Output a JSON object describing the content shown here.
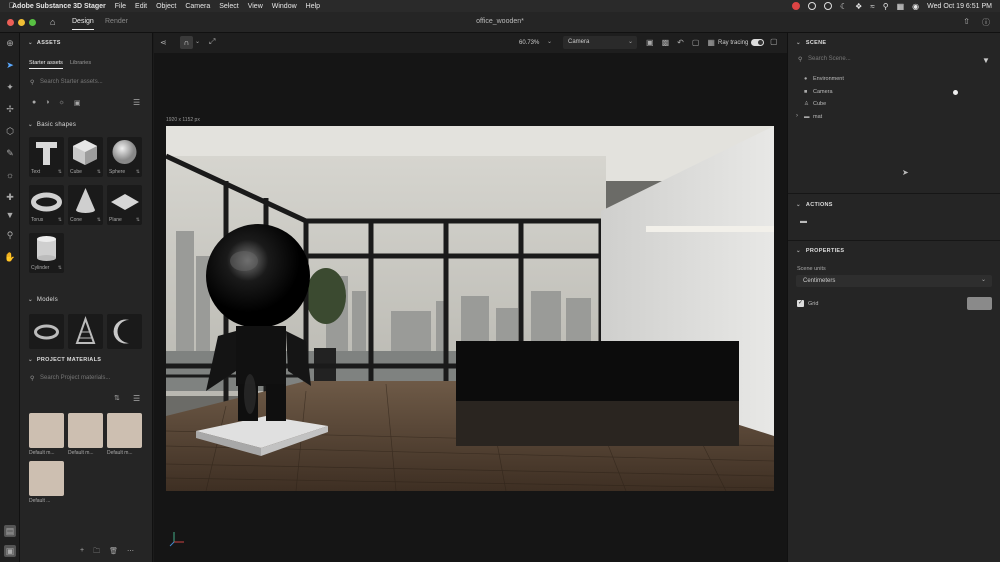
{
  "menubar": {
    "app_name": "Adobe Substance 3D Stager",
    "items": [
      "File",
      "Edit",
      "Object",
      "Camera",
      "Select",
      "View",
      "Window",
      "Help"
    ],
    "clock": "Wed Oct 19  6:51 PM"
  },
  "titlebar": {
    "tabs": [
      "Design",
      "Render"
    ],
    "document_title": "office_wooden*"
  },
  "left_panel": {
    "assets_header": "ASSETS",
    "asset_tabs": [
      "Starter assets",
      "Libraries"
    ],
    "search_placeholder": "Search Starter assets...",
    "basic_shapes_header": "Basic shapes",
    "shapes": [
      {
        "label": "Text"
      },
      {
        "label": "Cube"
      },
      {
        "label": "Sphere"
      },
      {
        "label": "Torus"
      },
      {
        "label": "Cone"
      },
      {
        "label": "Plane"
      },
      {
        "label": "Cylinder"
      }
    ],
    "models_header": "Models",
    "project_materials_header": "PROJECT MATERIALS",
    "materials_search_placeholder": "Search Project materials...",
    "materials": [
      {
        "label": "Default m..."
      },
      {
        "label": "Default m..."
      },
      {
        "label": "Default m..."
      },
      {
        "label": "Default ..."
      }
    ]
  },
  "viewport": {
    "zoom": "60.73%",
    "camera": "Camera",
    "ray_tracing_label": "Ray tracing",
    "ray_tracing_on": true,
    "resolution": "1920 x 1152 px"
  },
  "right_panel": {
    "scene_header": "SCENE",
    "scene_search_placeholder": "Search Scene...",
    "scene_items": [
      {
        "label": "Environment",
        "icon": "globe-icon"
      },
      {
        "label": "Camera",
        "icon": "camera-icon"
      },
      {
        "label": "Cube",
        "icon": "person-icon"
      },
      {
        "label": "mat",
        "icon": "folder-icon"
      }
    ],
    "actions_header": "ACTIONS",
    "properties_header": "PROPERTIES",
    "scene_units_label": "Scene units",
    "scene_units_value": "Centimeters",
    "grid_label": "Grid",
    "grid_checked": true
  },
  "colors": {
    "accent": "#e8e8e8",
    "panel": "#252525",
    "material_swatch": "#cdbfb1"
  }
}
